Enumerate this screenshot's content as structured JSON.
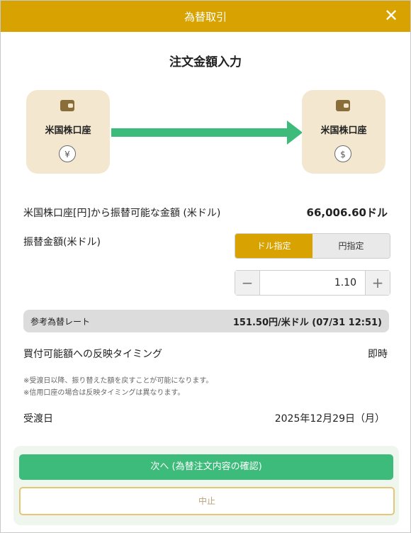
{
  "dialog": {
    "title": "為替取引",
    "close": "✕"
  },
  "heading": "注文金額入力",
  "from_account": {
    "label": "米国株口座",
    "currency_symbol": "¥"
  },
  "to_account": {
    "label": "米国株口座",
    "currency_symbol": "$"
  },
  "available": {
    "label": "米国株口座[円]から振替可能な金額 (米ドル)",
    "value": "66,006.60ドル"
  },
  "transfer": {
    "label": "振替金額(米ドル)",
    "toggle_usd": "ドル指定",
    "toggle_jpy": "円指定",
    "amount": "1.10",
    "minus": "−",
    "plus": "+"
  },
  "rate": {
    "label": "参考為替レート",
    "value": "151.50円/米ドル (07/31 12:51)"
  },
  "timing": {
    "label": "買付可能額への反映タイミング",
    "value": "即時"
  },
  "notes": [
    "※受渡日以降、振り替えた額を戻すことが可能になります。",
    "※信用口座の場合は反映タイミングは異なります。"
  ],
  "settlement": {
    "label": "受渡日",
    "value": "2025年12月29日（月）"
  },
  "actions": {
    "next": "次へ (為替注文内容の確認)",
    "cancel": "中止"
  },
  "colors": {
    "header": "#d8a300",
    "accent_green": "#3dbb7a",
    "card_bg": "#f3e8cf"
  }
}
